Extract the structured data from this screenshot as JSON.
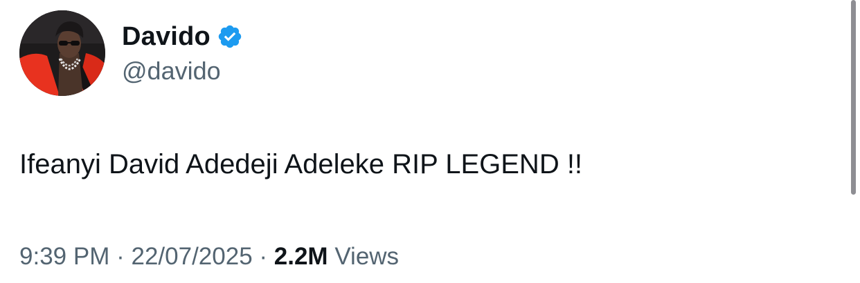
{
  "author": {
    "display_name": "Davido",
    "handle": "@davido",
    "verified": true
  },
  "tweet": {
    "text": "Ifeanyi David Adedeji Adeleke RIP LEGEND !!"
  },
  "meta": {
    "time": "9:39 PM",
    "separator": "·",
    "date": "22/07/2025",
    "views_count": "2.2M",
    "views_label": "Views"
  },
  "icons": {
    "verified": "verified-badge-icon"
  },
  "colors": {
    "primary_text": "#0f1419",
    "secondary_text": "#536471",
    "verified_blue": "#1d9bf0",
    "avatar_jacket": "#e8321f"
  }
}
